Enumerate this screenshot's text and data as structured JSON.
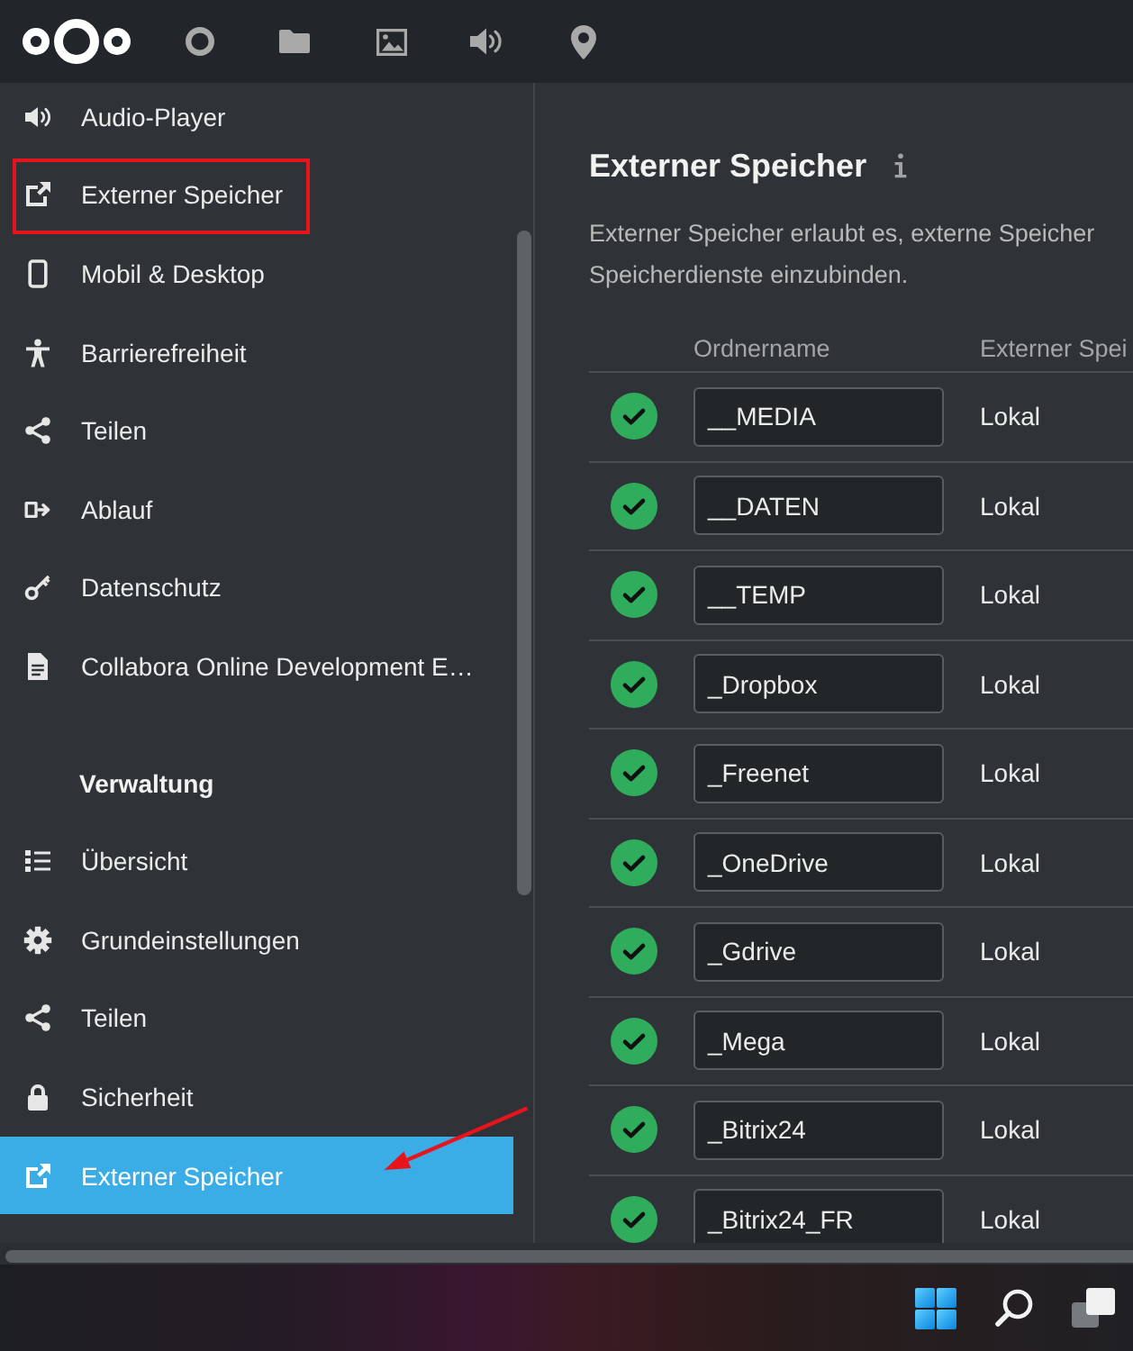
{
  "sidebar": {
    "sections": [
      {
        "items": [
          {
            "label": "Audio-Player",
            "selected": false,
            "framed": false,
            "arrow": false
          },
          {
            "label": "Externer Speicher",
            "selected": false,
            "framed": true,
            "arrow": false
          },
          {
            "label": "Mobil & Desktop",
            "selected": false,
            "framed": false,
            "arrow": false
          },
          {
            "label": "Barrierefreiheit",
            "selected": false,
            "framed": false,
            "arrow": false
          },
          {
            "label": "Teilen",
            "selected": false,
            "framed": false,
            "arrow": false
          },
          {
            "label": "Ablauf",
            "selected": false,
            "framed": false,
            "arrow": false
          },
          {
            "label": "Datenschutz",
            "selected": false,
            "framed": false,
            "arrow": false
          },
          {
            "label": "Collabora Online Development E…",
            "selected": false,
            "framed": false,
            "arrow": false
          }
        ]
      },
      {
        "heading": "Verwaltung",
        "items": [
          {
            "label": "Übersicht",
            "selected": false,
            "framed": false,
            "arrow": false
          },
          {
            "label": "Grundeinstellungen",
            "selected": false,
            "framed": false,
            "arrow": false
          },
          {
            "label": "Teilen",
            "selected": false,
            "framed": false,
            "arrow": false
          },
          {
            "label": "Sicherheit",
            "selected": false,
            "framed": false,
            "arrow": false
          },
          {
            "label": "Externer Speicher",
            "selected": true,
            "framed": false,
            "arrow": true
          }
        ]
      }
    ]
  },
  "main": {
    "title": "Externer Speicher",
    "description": "Externer Speicher erlaubt es, externe Speicher\nSpeicherdienste einzubinden.",
    "table": {
      "headers": [
        "Ordnername",
        "Externer Spei"
      ],
      "rows": [
        {
          "ok": true,
          "folder_name": "__MEDIA",
          "column_3": "Lokal"
        },
        {
          "ok": true,
          "folder_name": "__DATEN",
          "column_3": "Lokal"
        },
        {
          "ok": true,
          "folder_name": "__TEMP",
          "column_3": "Lokal"
        },
        {
          "ok": true,
          "folder_name": "_Dropbox",
          "column_3": "Lokal"
        },
        {
          "ok": true,
          "folder_name": "_Freenet",
          "column_3": "Lokal"
        },
        {
          "ok": true,
          "folder_name": "_OneDrive",
          "column_3": "Lokal"
        },
        {
          "ok": true,
          "folder_name": "_Gdrive",
          "column_3": "Lokal"
        },
        {
          "ok": true,
          "folder_name": "_Mega",
          "column_3": "Lokal"
        },
        {
          "ok": true,
          "folder_name": "_Bitrix24",
          "column_3": "Lokal"
        },
        {
          "ok": true,
          "folder_name": "_Bitrix24_FR",
          "column_3": "Lokal"
        }
      ]
    }
  }
}
